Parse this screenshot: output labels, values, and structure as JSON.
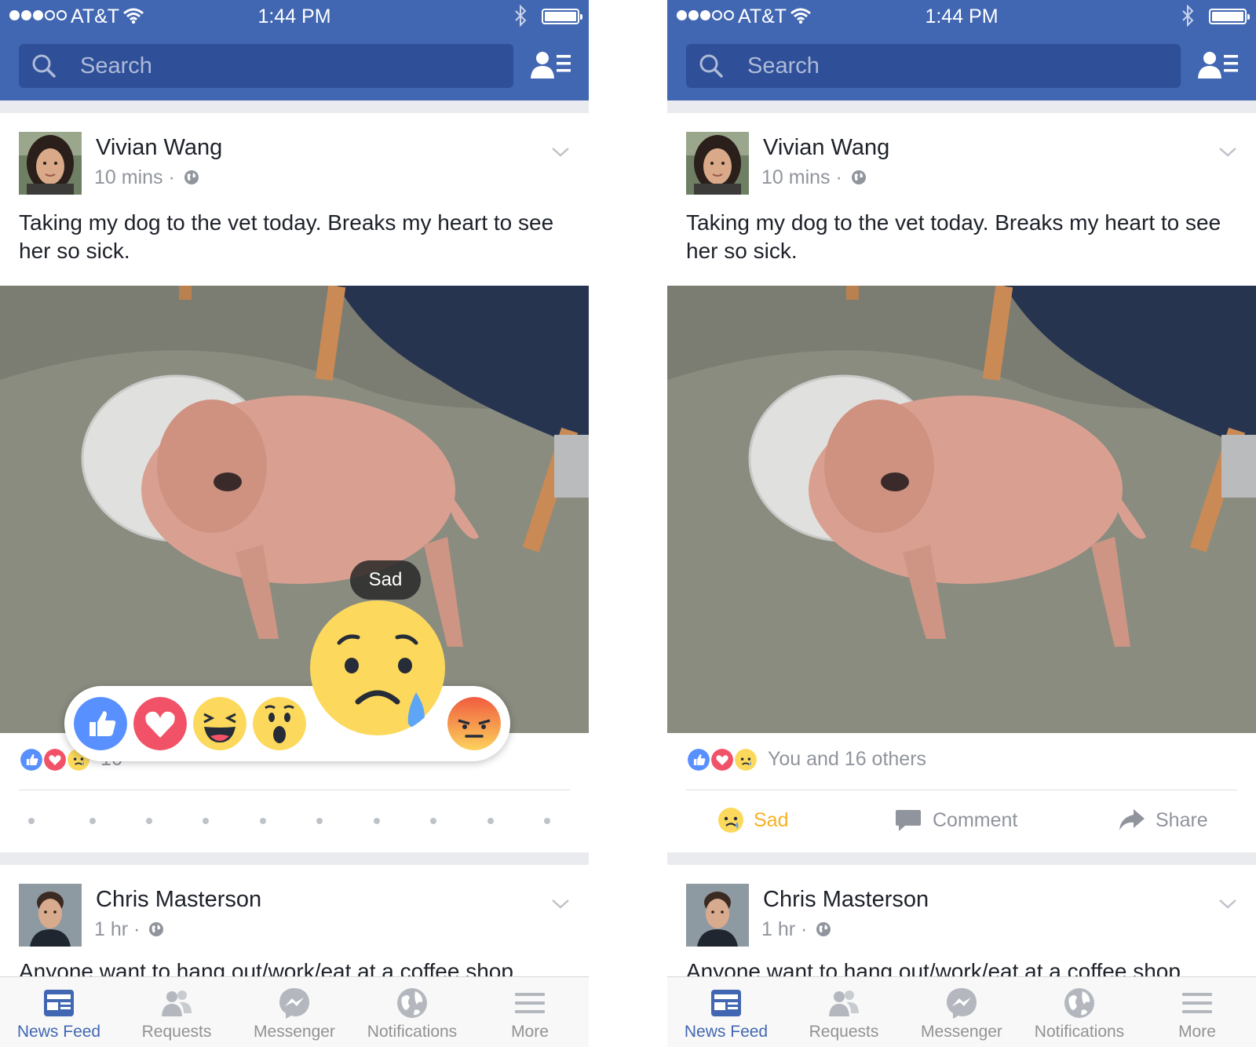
{
  "status_bar": {
    "carrier": "AT&T",
    "time": "1:44 PM"
  },
  "search": {
    "placeholder": "Search"
  },
  "posts": [
    {
      "author": "Vivian Wang",
      "time": "10 mins",
      "separator": "·",
      "text": "Taking my dog to the vet today. Breaks my heart to see her so sick."
    },
    {
      "author": "Chris Masterson",
      "time": "1 hr",
      "separator": "·",
      "text": "Anyone want to hang out/work/eat at a coffee shop"
    }
  ],
  "left_screen": {
    "reaction_count": "16",
    "tooltip": "Sad",
    "reactions": [
      "Like",
      "Love",
      "Haha",
      "Wow",
      "Sad",
      "Angry"
    ]
  },
  "right_screen": {
    "reaction_summary": "You and 16 others",
    "actions": {
      "sad": "Sad",
      "comment": "Comment",
      "share": "Share"
    }
  },
  "tabs": [
    {
      "label": "News Feed",
      "icon": "news-feed-icon",
      "active": true
    },
    {
      "label": "Requests",
      "icon": "requests-icon",
      "active": false
    },
    {
      "label": "Messenger",
      "icon": "messenger-icon",
      "active": false
    },
    {
      "label": "Notifications",
      "icon": "globe-icon",
      "active": false
    },
    {
      "label": "More",
      "icon": "menu-icon",
      "active": false
    }
  ],
  "colors": {
    "brand_blue": "#4267b2",
    "search_bg": "#2f4f98",
    "sad_yellow": "#f7b125",
    "love_red": "#f25268",
    "muted_text": "#90949c"
  }
}
